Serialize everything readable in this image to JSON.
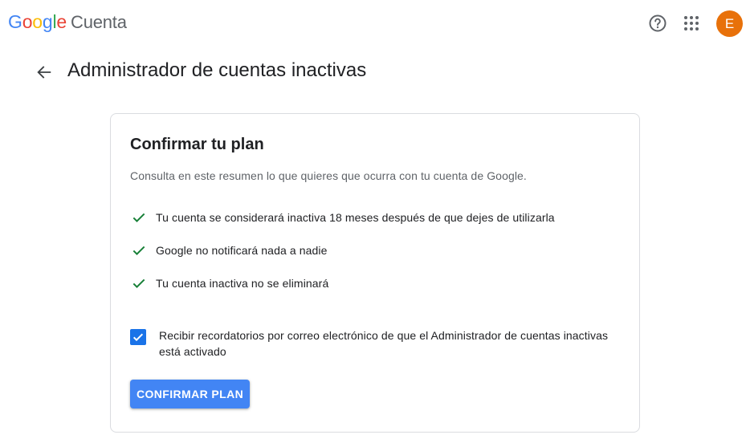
{
  "header": {
    "brand_letters": [
      "G",
      "o",
      "o",
      "g",
      "l",
      "e"
    ],
    "brand_colors": [
      "#4285F4",
      "#EA4335",
      "#FBBC05",
      "#4285F4",
      "#34A853",
      "#EA4335"
    ],
    "product": "Cuenta",
    "help_icon": "help-circle-icon",
    "apps_icon": "apps-grid-icon",
    "avatar_initial": "E",
    "avatar_color": "#e8710a"
  },
  "page": {
    "back_icon": "arrow-back-icon",
    "title": "Administrador de cuentas inactivas"
  },
  "card": {
    "title": "Confirmar tu plan",
    "description": "Consulta en este resumen lo que quieres que ocurra con tu cuenta de Google.",
    "items": [
      {
        "icon": "check-icon",
        "text": "Tu cuenta se considerará inactiva 18 meses después de que dejes de utilizarla"
      },
      {
        "icon": "check-icon",
        "text": "Google no notificará nada a nadie"
      },
      {
        "icon": "check-icon",
        "text": "Tu cuenta inactiva no se eliminará"
      }
    ],
    "check_color": "#188038",
    "reminder": {
      "checked": true,
      "label": "Recibir recordatorios por correo electrónico de que el Administrador de cuentas inactivas está activado"
    },
    "confirm_button": "CONFIRMAR PLAN"
  }
}
